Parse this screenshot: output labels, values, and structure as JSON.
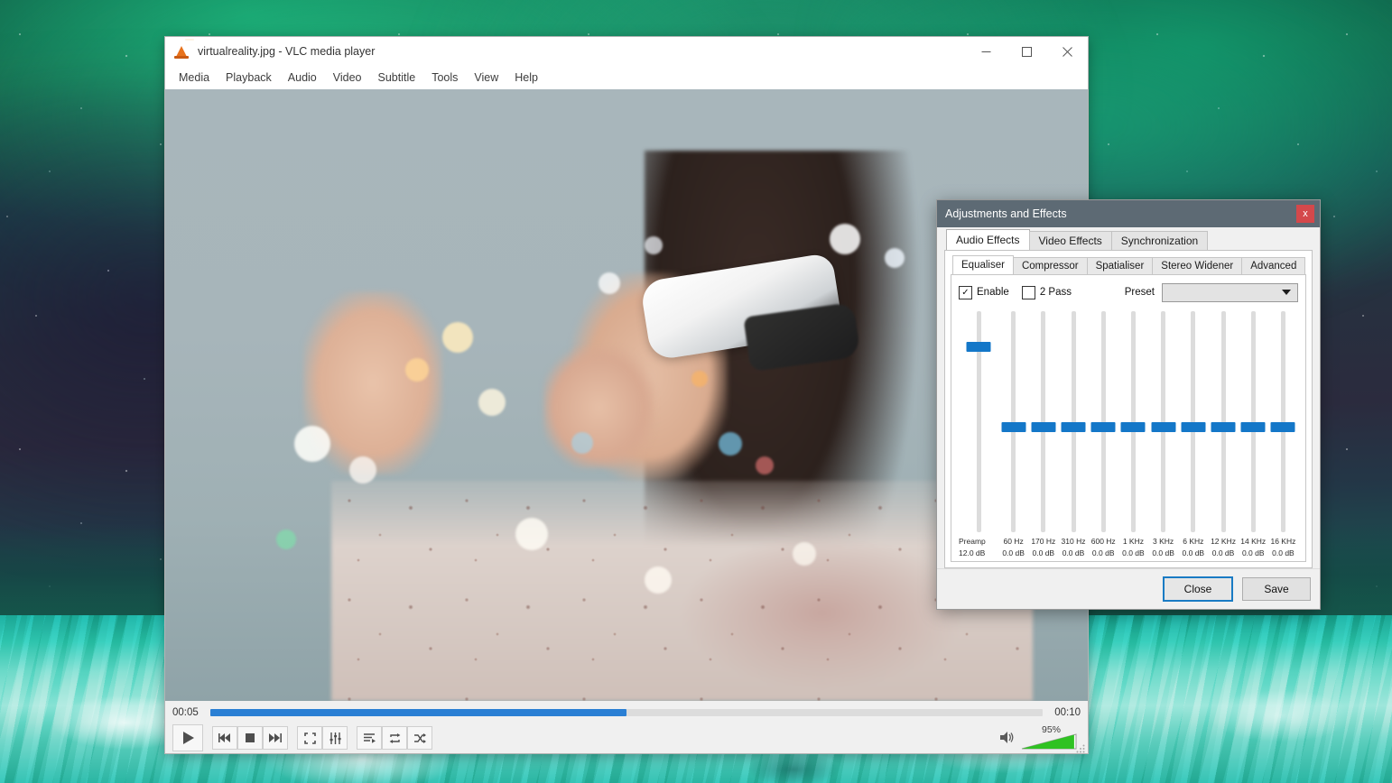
{
  "vlc": {
    "title": "virtualreality.jpg - VLC media player",
    "icon": "vlc-cone-icon",
    "window_buttons": {
      "minimize": "minimize-icon",
      "maximize": "maximize-icon",
      "close": "close-icon"
    },
    "menus": [
      "Media",
      "Playback",
      "Audio",
      "Video",
      "Subtitle",
      "Tools",
      "View",
      "Help"
    ],
    "playback": {
      "elapsed": "00:05",
      "total": "00:10",
      "progress_percent": 50,
      "controls": [
        {
          "name": "play-button",
          "icon": "play-icon"
        },
        {
          "name": "previous-button",
          "icon": "previous-icon"
        },
        {
          "name": "stop-button",
          "icon": "stop-icon"
        },
        {
          "name": "next-button",
          "icon": "next-icon"
        },
        {
          "name": "fullscreen-button",
          "icon": "fullscreen-icon"
        },
        {
          "name": "extended-settings-button",
          "icon": "equalizer-sliders-icon"
        },
        {
          "name": "playlist-button",
          "icon": "playlist-icon"
        },
        {
          "name": "loop-button",
          "icon": "loop-icon"
        },
        {
          "name": "shuffle-button",
          "icon": "shuffle-icon"
        }
      ],
      "volume": {
        "label": "95%",
        "value": 95,
        "icon": "speaker-icon"
      }
    }
  },
  "dialog": {
    "title": "Adjustments and Effects",
    "close_label": "x",
    "tabs_primary": [
      {
        "label": "Audio Effects",
        "active": true
      },
      {
        "label": "Video Effects",
        "active": false
      },
      {
        "label": "Synchronization",
        "active": false
      }
    ],
    "tabs_secondary": [
      {
        "label": "Equaliser",
        "active": true
      },
      {
        "label": "Compressor",
        "active": false
      },
      {
        "label": "Spatialiser",
        "active": false
      },
      {
        "label": "Stereo Widener",
        "active": false
      },
      {
        "label": "Advanced",
        "active": false
      }
    ],
    "equaliser": {
      "enable": {
        "label": "Enable",
        "checked": true,
        "mark": "✓"
      },
      "two_pass": {
        "label": "2 Pass",
        "checked": false,
        "mark": ""
      },
      "preset_label": "Preset",
      "preset_value": "",
      "preamp": {
        "label": "Preamp",
        "value": "12.0 dB",
        "position_percent": 86
      },
      "bands": [
        {
          "label": "60 Hz",
          "value": "0.0 dB",
          "position_percent": 50
        },
        {
          "label": "170 Hz",
          "value": "0.0 dB",
          "position_percent": 50
        },
        {
          "label": "310 Hz",
          "value": "0.0 dB",
          "position_percent": 50
        },
        {
          "label": "600 Hz",
          "value": "0.0 dB",
          "position_percent": 50
        },
        {
          "label": "1 KHz",
          "value": "0.0 dB",
          "position_percent": 50
        },
        {
          "label": "3 KHz",
          "value": "0.0 dB",
          "position_percent": 50
        },
        {
          "label": "6 KHz",
          "value": "0.0 dB",
          "position_percent": 50
        },
        {
          "label": "12 KHz",
          "value": "0.0 dB",
          "position_percent": 50
        },
        {
          "label": "14 KHz",
          "value": "0.0 dB",
          "position_percent": 50
        },
        {
          "label": "16 KHz",
          "value": "0.0 dB",
          "position_percent": 50
        }
      ]
    },
    "buttons": {
      "close": "Close",
      "save": "Save"
    },
    "colors": {
      "titlebar": "#5d6a74",
      "close_button": "#d4484b",
      "slider_handle": "#1477c8",
      "focus_border": "#1a7bc4"
    }
  }
}
